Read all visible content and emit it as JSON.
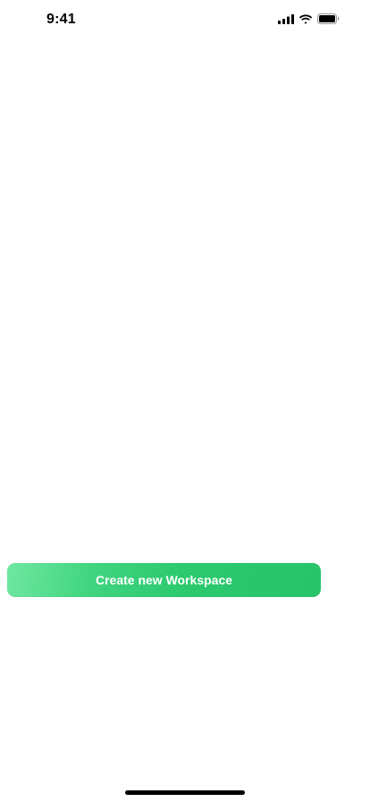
{
  "status_bar": {
    "time": "9:41",
    "icons": [
      "cellular-signal-icon",
      "wifi-icon",
      "battery-icon"
    ]
  },
  "main": {
    "create_workspace_label": "Create new Workspace"
  },
  "colors": {
    "button_gradient_start": "#6fe7a0",
    "button_gradient_end": "#28c46b",
    "button_text": "#ffffff",
    "background": "#ffffff"
  }
}
